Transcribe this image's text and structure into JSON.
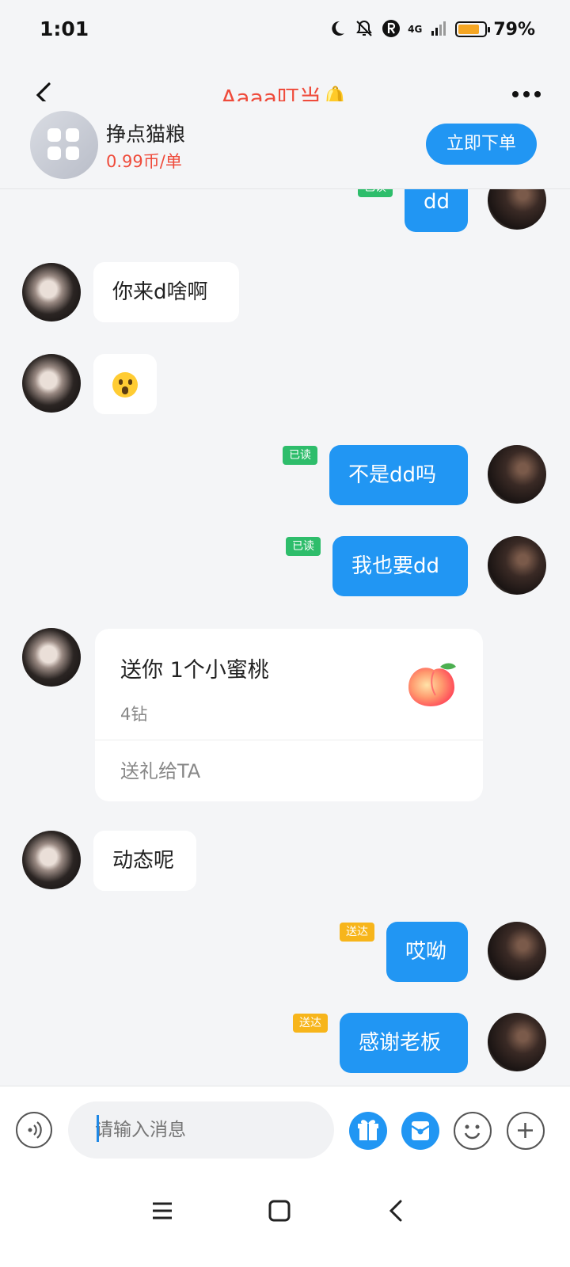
{
  "status_bar": {
    "time": "1:01",
    "network": "4G",
    "battery_percent": "79%",
    "battery_level": 0.79
  },
  "header": {
    "title": "Aaaa叮当🔔"
  },
  "order": {
    "name": "挣点猫粮",
    "price": "0.99币/单",
    "button": "立即下单"
  },
  "messages": [
    {
      "side": "right",
      "text": "dd"
    },
    {
      "side": "left",
      "text": "你来d啥啊"
    },
    {
      "side": "left",
      "emoji": "hushed-face"
    },
    {
      "side": "right",
      "text": "不是dd吗",
      "tag": "已读"
    },
    {
      "side": "right",
      "text": "我也要dd",
      "tag": "已读"
    },
    {
      "side": "left",
      "gift": {
        "title": "送你 1个小蜜桃",
        "cost": "4钻",
        "action": "送礼给TA"
      }
    },
    {
      "side": "left",
      "text": "动态呢"
    },
    {
      "side": "right",
      "text": "哎呦",
      "tag": "送达"
    },
    {
      "side": "right",
      "text": "感谢老板",
      "tag": "送达"
    }
  ],
  "input": {
    "placeholder": "请输入消息"
  },
  "colors": {
    "accent": "#2196f3",
    "title_red": "#ef4b3b",
    "read_tag": "#2ebd6b",
    "sent_tag": "#f7b51b"
  }
}
